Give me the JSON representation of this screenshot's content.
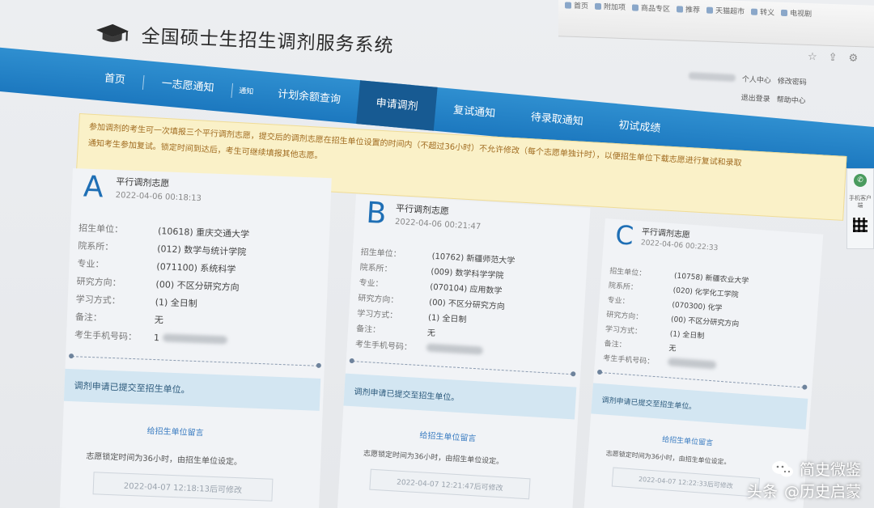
{
  "browser": {
    "bookmarks": [
      "首页",
      "附加项",
      "商品专区",
      "推荐",
      "天猫超市",
      "转义",
      "电视剧"
    ]
  },
  "header": {
    "title": "全国硕士生招生调剂服务系统"
  },
  "user_links": {
    "personal_center": "个人中心",
    "change_password": "修改密码",
    "logout": "退出登录",
    "help_center": "帮助中心"
  },
  "nav": {
    "tabs": [
      {
        "label": "首页"
      },
      {
        "label": "一志愿通知"
      },
      {
        "label": "通知"
      },
      {
        "label": "计划余额查询"
      },
      {
        "label": "申请调剂"
      },
      {
        "label": "复试通知"
      },
      {
        "label": "待录取通知"
      },
      {
        "label": "初试成绩"
      }
    ],
    "active": "申请调剂"
  },
  "notice": {
    "line1": "参加调剂的考生可一次填报三个平行调剂志愿，提交后的调剂志愿在招生单位设置的时间内（不超过36小时）不允许修改（每个志愿单独计时），以便招生单位下载志愿进行复试和录取",
    "line2": "通知考生参加复试。锁定时间到达后，考生可继续填报其他志愿。"
  },
  "volunteers": [
    {
      "letter": "A",
      "title": "平行调剂志愿",
      "time": "2022-04-06 00:18:13",
      "fields": [
        {
          "label": "招生单位：",
          "value": "(10618) 重庆交通大学"
        },
        {
          "label": "院系所：",
          "value": "(012) 数学与统计学院"
        },
        {
          "label": "专业：",
          "value": "(071100) 系统科学"
        },
        {
          "label": "研究方向：",
          "value": "(00) 不区分研究方向"
        },
        {
          "label": "学习方式：",
          "value": "(1) 全日制"
        },
        {
          "label": "备注：",
          "value": "无"
        },
        {
          "label": "考生手机号码：",
          "value": "1"
        }
      ],
      "status": "调剂申请已提交至招生单位。",
      "reply_link": "给招生单位留言",
      "lock_note": "志愿锁定时间为36小时，由招生单位设定。",
      "lock_time": "2022-04-07 12:18:13后可修改"
    },
    {
      "letter": "B",
      "title": "平行调剂志愿",
      "time": "2022-04-06 00:21:47",
      "fields": [
        {
          "label": "招生单位：",
          "value": "(10762) 新疆师范大学"
        },
        {
          "label": "院系所：",
          "value": "(009) 数学科学学院"
        },
        {
          "label": "专业：",
          "value": "(070104) 应用数学"
        },
        {
          "label": "研究方向：",
          "value": "(00) 不区分研究方向"
        },
        {
          "label": "学习方式：",
          "value": "(1) 全日制"
        },
        {
          "label": "备注：",
          "value": "无"
        },
        {
          "label": "考生手机号码：",
          "value": ""
        }
      ],
      "status": "调剂申请已提交至招生单位。",
      "reply_link": "给招生单位留言",
      "lock_note": "志愿锁定时间为36小时，由招生单位设定。",
      "lock_time": "2022-04-07 12:21:47后可修改"
    },
    {
      "letter": "C",
      "title": "平行调剂志愿",
      "time": "2022-04-06 00:22:33",
      "fields": [
        {
          "label": "招生单位：",
          "value": "(10758) 新疆农业大学"
        },
        {
          "label": "院系所：",
          "value": "(020) 化学化工学院"
        },
        {
          "label": "专业：",
          "value": "(070300) 化学"
        },
        {
          "label": "研究方向：",
          "value": "(00) 不区分研究方向"
        },
        {
          "label": "学习方式：",
          "value": "(1) 全日制"
        },
        {
          "label": "备注：",
          "value": "无"
        },
        {
          "label": "考生手机号码：",
          "value": ""
        }
      ],
      "status": "调剂申请已提交至招生单位。",
      "reply_link": "给招生单位留言",
      "lock_note": "志愿锁定时间为36小时，由招生单位设定。",
      "lock_time": "2022-04-07 12:22:33后可修改"
    }
  ],
  "side_widget": {
    "label": "手机客户端"
  },
  "watermark": {
    "brand_top": "简史微鉴",
    "platform": "头条",
    "handle": "@历史启蒙"
  },
  "colors": {
    "nav_blue": "#1c78bf",
    "nav_active": "#175a92",
    "notice_bg": "#faf1c8",
    "notice_text": "#a06b20",
    "letter_blue": "#1f6fb5",
    "status_bg": "#d3e6f2"
  }
}
